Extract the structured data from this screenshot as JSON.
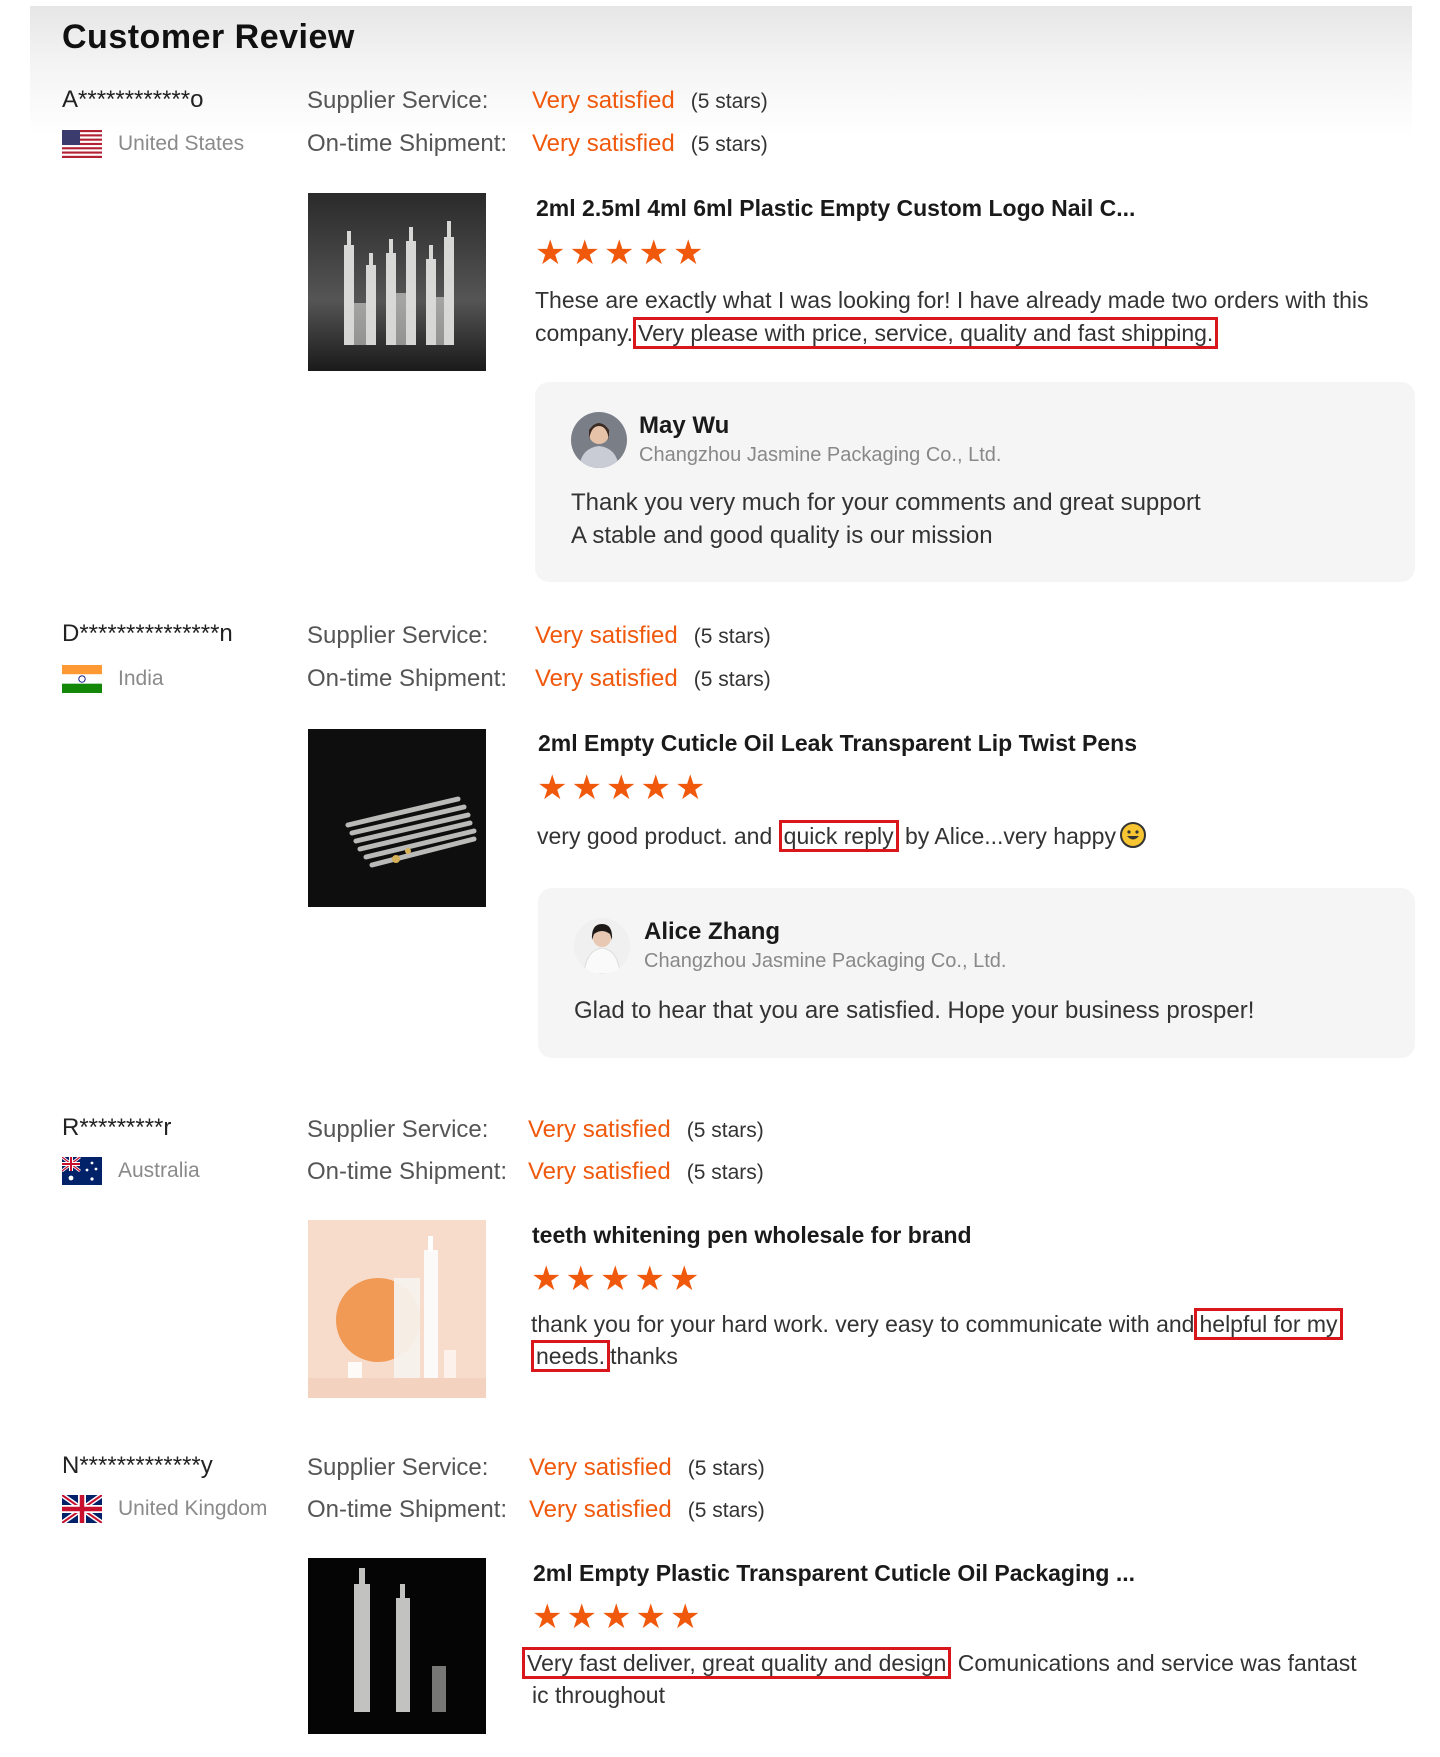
{
  "page": {
    "title": "Customer Review"
  },
  "labels": {
    "supplier_service": "Supplier Service:",
    "ontime_shipment": "On-time Shipment:"
  },
  "colors": {
    "accent": "#f0580c",
    "highlight_box": "#d9161b"
  },
  "reviews": [
    {
      "name": "A************o",
      "country": "United States",
      "flag_icon": "us-flag-icon",
      "supplier_value": "Very satisfied",
      "supplier_stars": "(5 stars)",
      "shipment_value": "Very satisfied",
      "shipment_stars": "(5 stars)",
      "product": "2ml 2.5ml 4ml 6ml Plastic Empty Custom Logo Nail C...",
      "rating": 5,
      "comment_pre": "These are exactly what I was looking for! I have already made two orders with this company.",
      "comment_hl": "Very please with price, service, quality  and fast shipping.",
      "reply": {
        "name": "May Wu",
        "company": "Changzhou Jasmine Packaging Co., Ltd.",
        "line1": "Thank you very much for your comments and great support",
        "line2": "A stable and good quality is our mission"
      }
    },
    {
      "name": "D***************n",
      "country": "India",
      "flag_icon": "india-flag-icon",
      "supplier_value": "Very satisfied",
      "supplier_stars": "(5 stars)",
      "shipment_value": "Very satisfied",
      "shipment_stars": "(5 stars)",
      "product": "2ml Empty Cuticle Oil Leak Transparent Lip Twist Pens",
      "rating": 5,
      "comment_pre": "very good product. and",
      "comment_hl": "quick reply",
      "comment_post": "by Alice...very happy",
      "reply": {
        "name": "Alice Zhang",
        "company": "Changzhou Jasmine Packaging Co., Ltd.",
        "line1": "Glad to hear that you are satisfied. Hope your business prosper!"
      }
    },
    {
      "name": "R*********r",
      "country": "Australia",
      "flag_icon": "australia-flag-icon",
      "supplier_value": "Very satisfied",
      "supplier_stars": "(5 stars)",
      "shipment_value": "Very satisfied",
      "shipment_stars": "(5 stars)",
      "product": "teeth whitening pen wholesale for brand",
      "rating": 5,
      "comment_pre": "thank you for your hard work. very easy to communicate with and",
      "comment_hl1": "helpful for my",
      "comment_hl2": "needs.",
      "comment_post": "thanks"
    },
    {
      "name": "N*************y",
      "country": "United Kingdom",
      "flag_icon": "uk-flag-icon",
      "supplier_value": "Very satisfied",
      "supplier_stars": "(5 stars)",
      "shipment_value": "Very satisfied",
      "shipment_stars": "(5 stars)",
      "product": "2ml Empty Plastic Transparent Cuticle Oil Packaging ...",
      "rating": 5,
      "comment_hl": "Very fast deliver, great quality and design",
      "comment_post": " Comunications and service was fantast",
      "comment_post2": "ic throughout"
    }
  ]
}
